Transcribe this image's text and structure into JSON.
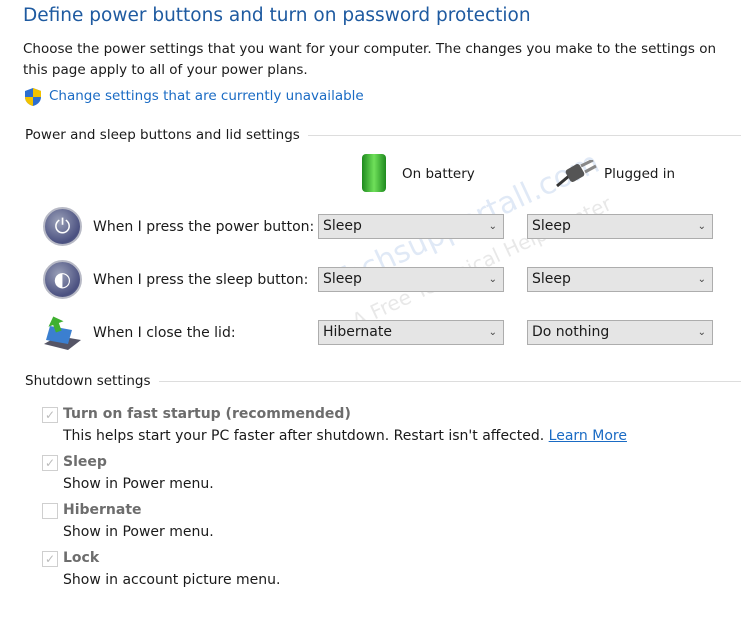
{
  "title": "Define power buttons and turn on password protection",
  "description": "Choose the power settings that you want for your computer. The changes you make to the settings on this page apply to all of your power plans.",
  "change_link": "Change settings that are currently unavailable",
  "power_section": {
    "header": "Power and sleep buttons and lid settings",
    "col_battery": "On battery",
    "col_plugged": "Plugged in",
    "rows": [
      {
        "label": "When I press the power button:",
        "battery": "Sleep",
        "plugged": "Sleep",
        "icon": "power-icon"
      },
      {
        "label": "When I press the sleep button:",
        "battery": "Sleep",
        "plugged": "Sleep",
        "icon": "sleep-icon"
      },
      {
        "label": "When I close the lid:",
        "battery": "Hibernate",
        "plugged": "Do nothing",
        "icon": "laptop-lid-icon"
      }
    ]
  },
  "shutdown_section": {
    "header": "Shutdown settings",
    "items": [
      {
        "label": "Turn on fast startup (recommended)",
        "desc": "This helps start your PC faster after shutdown. Restart isn't affected.",
        "link": "Learn More",
        "checked": true
      },
      {
        "label": "Sleep",
        "desc": "Show in Power menu.",
        "checked": true
      },
      {
        "label": "Hibernate",
        "desc": "Show in Power menu.",
        "checked": false
      },
      {
        "label": "Lock",
        "desc": "Show in account picture menu.",
        "checked": true
      }
    ]
  },
  "watermark": {
    "brand": "Techsupportall.com",
    "tagline": "A Free Technical Help center"
  }
}
